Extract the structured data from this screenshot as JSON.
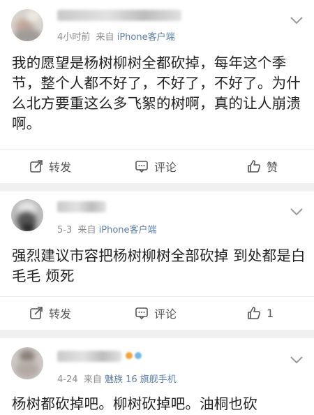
{
  "posts": [
    {
      "time": "4小时前",
      "source_prefix": "来自",
      "source": "iPhone客户端",
      "content": "我的愿望是杨树柳树全都砍掉，每年这个季节，整个人都不好了，不好了，不好了。为什么北方要重这么多飞絮的树啊，真的让人崩溃啊。",
      "actions": {
        "repost": "转发",
        "comment": "评论",
        "like": "赞"
      }
    },
    {
      "time": "5-3",
      "source_prefix": "来自",
      "source": "iPhone客户端",
      "content": "强烈建议市容把杨树柳树全部砍掉 到处都是白毛毛 烦死",
      "actions": {
        "repost": "转发",
        "comment": "评论",
        "like": "1"
      }
    },
    {
      "time": "4-24",
      "source_prefix": "来自",
      "source": "魅族 16 旗舰手机",
      "content": "杨树都砍掉吧。柳树砍掉吧。油桐也砍"
    }
  ],
  "colors": {
    "source_link": "#5b7fb0",
    "meta": "#8b8b8b",
    "separator": "#f0f0f0"
  },
  "icons": [
    "chevron-down-icon",
    "repost-icon",
    "comment-icon",
    "like-icon"
  ]
}
